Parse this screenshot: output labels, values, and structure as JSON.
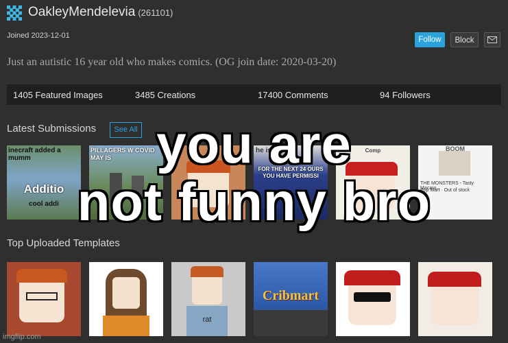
{
  "profile": {
    "username": "OakleyMendelevia",
    "user_id": "(261101)",
    "joined": "Joined 2023-12-01",
    "bio": "Just an autistic 16 year old who makes comics. (OG join date: 2020-03-20)"
  },
  "actions": {
    "follow_label": "Follow",
    "block_label": "Block"
  },
  "stats": {
    "featured": "1405 Featured Images",
    "creations": "3485 Creations",
    "comments": "17400 Comments",
    "followers": "94 Followers"
  },
  "latest": {
    "title": "Latest Submissions",
    "see_all_label": "See All",
    "thumbs": [
      {
        "caption_top": "inecraft added a mumm",
        "caption_mid": "Additio",
        "caption_bot": "cool addi"
      },
      {
        "caption_top": "PILLAGERS W COVID MAY IS"
      },
      {},
      {
        "caption_top": "he is Jeff",
        "caption_mid": "FOR THE NEXT 24 OURS YOU HAVE PERMISSI"
      },
      {
        "caption_top": "Comp"
      },
      {
        "caption_top": "THE MONSTERS - Tasty Macaro...",
        "caption_mid": "Pop Mart · Out of stock",
        "caption_bot": "BOOM"
      }
    ]
  },
  "top_templates": {
    "title": "Top Uploaded Templates",
    "store_sign": "Cribmart",
    "shirt_text": "rat"
  },
  "overlay": {
    "line1": "you are",
    "line2": "not funny bro"
  },
  "watermark": "imgflip.com",
  "colors": {
    "background": "#2f2f2f",
    "accent": "#2aa3dc",
    "stats_bar": "#1f1f1f"
  }
}
